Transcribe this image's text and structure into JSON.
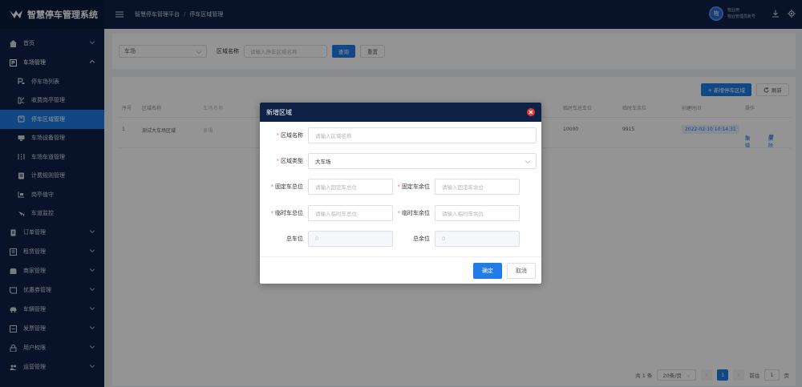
{
  "brand": {
    "title": "智慧停车管理系统"
  },
  "header": {
    "breadcrumb": [
      "智慧停车管理平台",
      "停车区域管理"
    ],
    "user_avatar": "物",
    "user_name": "物业用",
    "user_role": "物业管理员账号"
  },
  "sidebar": {
    "items": [
      {
        "label": "首页",
        "icon": "home-icon"
      },
      {
        "label": "车场管理",
        "icon": "parking-icon",
        "expanded": true
      },
      {
        "label": "停车场列表",
        "icon": "parking-list-icon"
      },
      {
        "label": "收费岗亭管理",
        "icon": "booth-icon"
      },
      {
        "label": "停车区域管理",
        "icon": "area-icon",
        "active": true
      },
      {
        "label": "车场设备管理",
        "icon": "device-icon"
      },
      {
        "label": "车场车道管理",
        "icon": "lane-icon"
      },
      {
        "label": "计费规则管理",
        "icon": "rule-icon"
      },
      {
        "label": "岗亭值守",
        "icon": "duty-icon"
      },
      {
        "label": "车道监控",
        "icon": "monitor-icon"
      },
      {
        "label": "订单管理",
        "icon": "order-icon"
      },
      {
        "label": "租赁管理",
        "icon": "lease-icon"
      },
      {
        "label": "商家管理",
        "icon": "merchant-icon"
      },
      {
        "label": "优惠券管理",
        "icon": "coupon-icon"
      },
      {
        "label": "车辆管理",
        "icon": "car-icon"
      },
      {
        "label": "发票管理",
        "icon": "invoice-icon"
      },
      {
        "label": "用户权限",
        "icon": "lock-icon"
      },
      {
        "label": "运营管理",
        "icon": "operation-icon"
      }
    ]
  },
  "filter": {
    "select_value": "车场",
    "area_label": "区域名称",
    "area_placeholder": "请输入停车区域名称",
    "search_label": "查询",
    "reset_label": "重置"
  },
  "toolbar": {
    "add_label": "+ 新增停车区域",
    "refresh_label": "刷新"
  },
  "table": {
    "headers": [
      "序号",
      "区域名称",
      "车场名称",
      "临时车总车位",
      "临时车余位",
      "创建时间",
      "操作"
    ],
    "rows": [
      {
        "index": "1",
        "name": "测试大车场区域",
        "lot": "車場",
        "temp_total": "10000",
        "temp_left": "9915",
        "created": "2022-02-10 10:14:31",
        "edit": "编辑",
        "delete": "删除"
      }
    ]
  },
  "pagination": {
    "total": "共 1 条",
    "page_size": "20条/页",
    "current": "1",
    "goto_label": "前往",
    "goto_value": "1",
    "page_unit": "页"
  },
  "modal": {
    "title": "新增区域",
    "area_name_label": "区域名称",
    "area_name_placeholder": "请输入区域名称",
    "area_type_label": "区域类型",
    "area_type_value": "大车场",
    "fixed_total_label": "固定车总位",
    "fixed_total_placeholder": "请输入固定车总位",
    "fixed_left_label": "固定车余位",
    "fixed_left_placeholder": "请输入固定车余位",
    "temp_total_label": "临时车总位",
    "temp_total_placeholder": "请输入临时车总位",
    "temp_left_label": "临时车余位",
    "temp_left_placeholder": "请输入临时车余位",
    "total_label": "总车位",
    "total_value": "0",
    "total_left_label": "总余位",
    "total_left_value": "0",
    "confirm_label": "确定",
    "cancel_label": "取消"
  },
  "colors": {
    "nav_bg": "#0e2147",
    "accent": "#1f7be6",
    "danger": "#e53a3a"
  }
}
